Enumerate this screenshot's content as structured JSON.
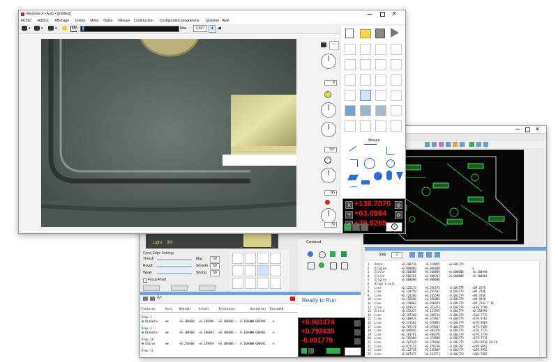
{
  "main": {
    "title": "Measure-X • Auto • [Untitled]",
    "menu": [
      "Fichier",
      "Edition",
      "Affichage",
      "Unités",
      "Mires",
      "Outils",
      "Mesure",
      "Construction",
      "Configuration programme",
      "Système",
      "Aide"
    ],
    "slider_min": "Min",
    "slider_max": "Max",
    "zoom_value": "0.807",
    "dial_values": [
      "0",
      "157",
      "65",
      "79"
    ]
  },
  "palette": {
    "section_label": "Mesure",
    "dro": {
      "x": "+138.7070",
      "y": "+63.0984",
      "z": "+29.9265"
    },
    "axis_labels": [
      "X",
      "Y",
      "Z"
    ]
  },
  "back": {
    "light_label": "Light",
    "light_value": "8%",
    "focus_title": "Focal Edge Settings",
    "focus_rows": [
      {
        "label": "Thresh",
        "right": "Max",
        "value": "50"
      },
      {
        "label": "Rough",
        "right": "Smooth",
        "value": "50"
      },
      {
        "label": "Weak",
        "right": "Strong",
        "value": "50"
      }
    ],
    "focus_point_label": "Focus Pixel",
    "construct_label": "Construct",
    "status_text": "Ready to Run",
    "dro": {
      "x": "+0.903374",
      "y": "+0.792635",
      "z": "-0.001779"
    },
    "table_headers": [
      "Features",
      "Unit",
      "Nominal",
      "Actual",
      "Tolerances",
      "Deviation",
      "Exceeded"
    ],
    "table_rows": [
      {
        "step": "Step 1",
        "name": "Diameter",
        "unit": "mm",
        "nominal": "+0.100000",
        "actual": "+0.100998",
        "tol": "+0.100000 / -0.100000",
        "dev": "+0.000998",
        "exc": "o"
      },
      {
        "step": "Step 2",
        "name": "Diameter",
        "unit": "mm",
        "nominal": "+0.100000",
        "actual": "+0.100001",
        "tol": "+0.100000 / -0.100000",
        "dev": "+0.000001",
        "exc": "o"
      },
      {
        "step": "Step 10",
        "name": "Radius",
        "unit": "mm",
        "nominal": "+0.250000",
        "actual": "+0.249958",
        "tol": "+0.100000 / -0.100000",
        "dev": "-0.000042",
        "exc": "o"
      },
      {
        "step": "Step 11",
        "name": "",
        "unit": "",
        "nominal": "",
        "actual": "",
        "tol": "",
        "dev": "",
        "exc": ""
      }
    ],
    "results_step_label": "Step",
    "results_step_value": "1",
    "results_rows": [
      {
        "n": "1",
        "name": "Point",
        "a": "+0.368716",
        "b": "-0.319825",
        "c": "+0.001779",
        "d": ""
      },
      {
        "n": "2",
        "name": "Origine",
        "a": "+0.000000",
        "b": "+0.000000",
        "c": "",
        "d": "1"
      },
      {
        "n": "3",
        "name": "Circle",
        "a": "+0.360888",
        "b": "+0.360888",
        "c": "+0.000000",
        "d": "+0.100998"
      },
      {
        "n": "4",
        "name": "Circle",
        "a": "+0.900701",
        "b": "+0.900701",
        "c": "+0.000000",
        "d": "+0.100001"
      },
      {
        "n": "5",
        "name": "Origine",
        "a": "+0.000000",
        "b": "+0.000000",
        "c": "",
        "d": ""
      },
      {
        "n": "6",
        "name": "Align X axis",
        "a": "",
        "b": "",
        "c": "",
        "d": ""
      },
      {
        "n": "7",
        "name": "Line",
        "a": "+0.122115",
        "b": "+0.355575",
        "c": "-0.001779",
        "d": "+89.5376"
      },
      {
        "n": "8",
        "name": "Line",
        "a": "+0.128750",
        "b": "+0.265597",
        "c": "-0.001779",
        "d": "+89.7486"
      },
      {
        "n": "9",
        "name": "Line",
        "a": "+0.128200",
        "b": "+0.265598",
        "c": "-0.001779",
        "d": "+89.7486"
      },
      {
        "n": "10",
        "name": "Line",
        "a": "+0.128500",
        "b": "+0.356888",
        "c": "-0.001779",
        "d": "+89.9950"
      },
      {
        "n": "11",
        "name": "Line",
        "a": "+0.128802",
        "b": "+0.356879",
        "c": "-0.001779",
        "d": "+89.7162 T:1C"
      },
      {
        "n": "12",
        "name": "Line",
        "a": "+0.083515",
        "b": "+0.353374",
        "c": "-0.001779",
        "d": "+138.7799"
      },
      {
        "n": "13",
        "name": "Circle",
        "a": "+0.372017",
        "b": "+0.121993",
        "c": "-0.001779",
        "d": "+0.250999"
      },
      {
        "n": "14",
        "name": "Line",
        "a": "+0.397260",
        "b": "+0.320711",
        "c": "-0.001779",
        "d": "+138.7715"
      },
      {
        "n": "15",
        "name": "Line",
        "a": "+0.380911",
        "b": "+0.375667",
        "c": "-0.001779",
        "d": "+178.9782"
      },
      {
        "n": "16",
        "name": "Line",
        "a": "+0.373562",
        "b": "+0.378881",
        "c": "-0.001779",
        "d": "+178.8063"
      },
      {
        "n": "17",
        "name": "Line",
        "a": "+0.787178",
        "b": "+0.375607",
        "c": "-0.001779",
        "d": "+179.7928"
      },
      {
        "n": "18",
        "name": "Line",
        "a": "+0.848026",
        "b": "+0.383376",
        "c": "-0.001779",
        "d": "+179.7775"
      },
      {
        "n": "19",
        "name": "Line",
        "a": "+0.781701",
        "b": "+0.380379",
        "c": "-0.001779",
        "d": "+179.7779"
      },
      {
        "n": "20",
        "name": "Line",
        "a": "+0.765609",
        "b": "+0.379509",
        "c": "-0.001779",
        "d": "+179.7774"
      },
      {
        "n": "21",
        "name": "Line",
        "a": "+0.707439",
        "b": "+0.379606",
        "c": "-0.001779",
        "d": "+359.9918 10:19"
      },
      {
        "n": "22",
        "name": "Line",
        "a": "+0.827175",
        "b": "+0.378739",
        "c": "-0.001787",
        "d": "+269.9952"
      },
      {
        "n": "23",
        "name": "Line",
        "a": "+0.122738",
        "b": "+0.183889",
        "c": "-0.001779",
        "d": "+269.9932"
      },
      {
        "n": "24",
        "name": "Line",
        "a": "+0.007975",
        "b": "+0.183771",
        "c": "-0.001779",
        "d": "+269.7662"
      }
    ]
  }
}
